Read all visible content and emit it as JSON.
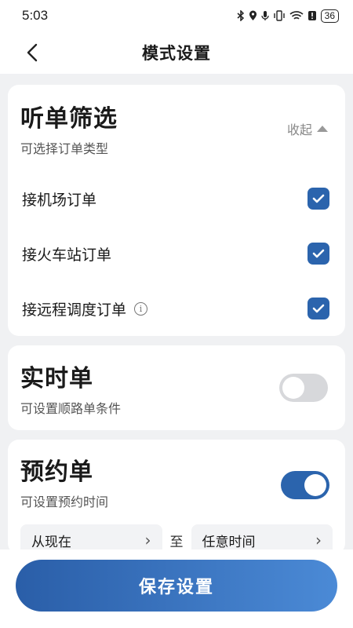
{
  "status": {
    "time": "5:03",
    "battery": "36",
    "icons": [
      "bluetooth-icon",
      "location-icon",
      "mic-icon",
      "vibrate-icon",
      "wifi-icon",
      "alert-icon"
    ]
  },
  "nav": {
    "title": "模式设置",
    "back_icon": "chevron-left-icon"
  },
  "filter": {
    "title": "听单筛选",
    "subtitle": "可选择订单类型",
    "collapse_label": "收起",
    "options": [
      {
        "label": "接机场订单",
        "checked": true
      },
      {
        "label": "接火车站订单",
        "checked": true
      },
      {
        "label": "接远程调度订单",
        "checked": true,
        "info": "i"
      }
    ]
  },
  "realtime": {
    "title": "实时单",
    "subtitle": "可设置顺路单条件",
    "enabled": false
  },
  "booking": {
    "title": "预约单",
    "subtitle": "可设置预约时间",
    "enabled": true,
    "from_label": "从现在",
    "separator": "至",
    "to_label": "任意时间"
  },
  "save_label": "保存设置",
  "colors": {
    "accent": "#2b64ad",
    "toggle_off": "#d7d8db",
    "background": "#f0f1f3"
  }
}
